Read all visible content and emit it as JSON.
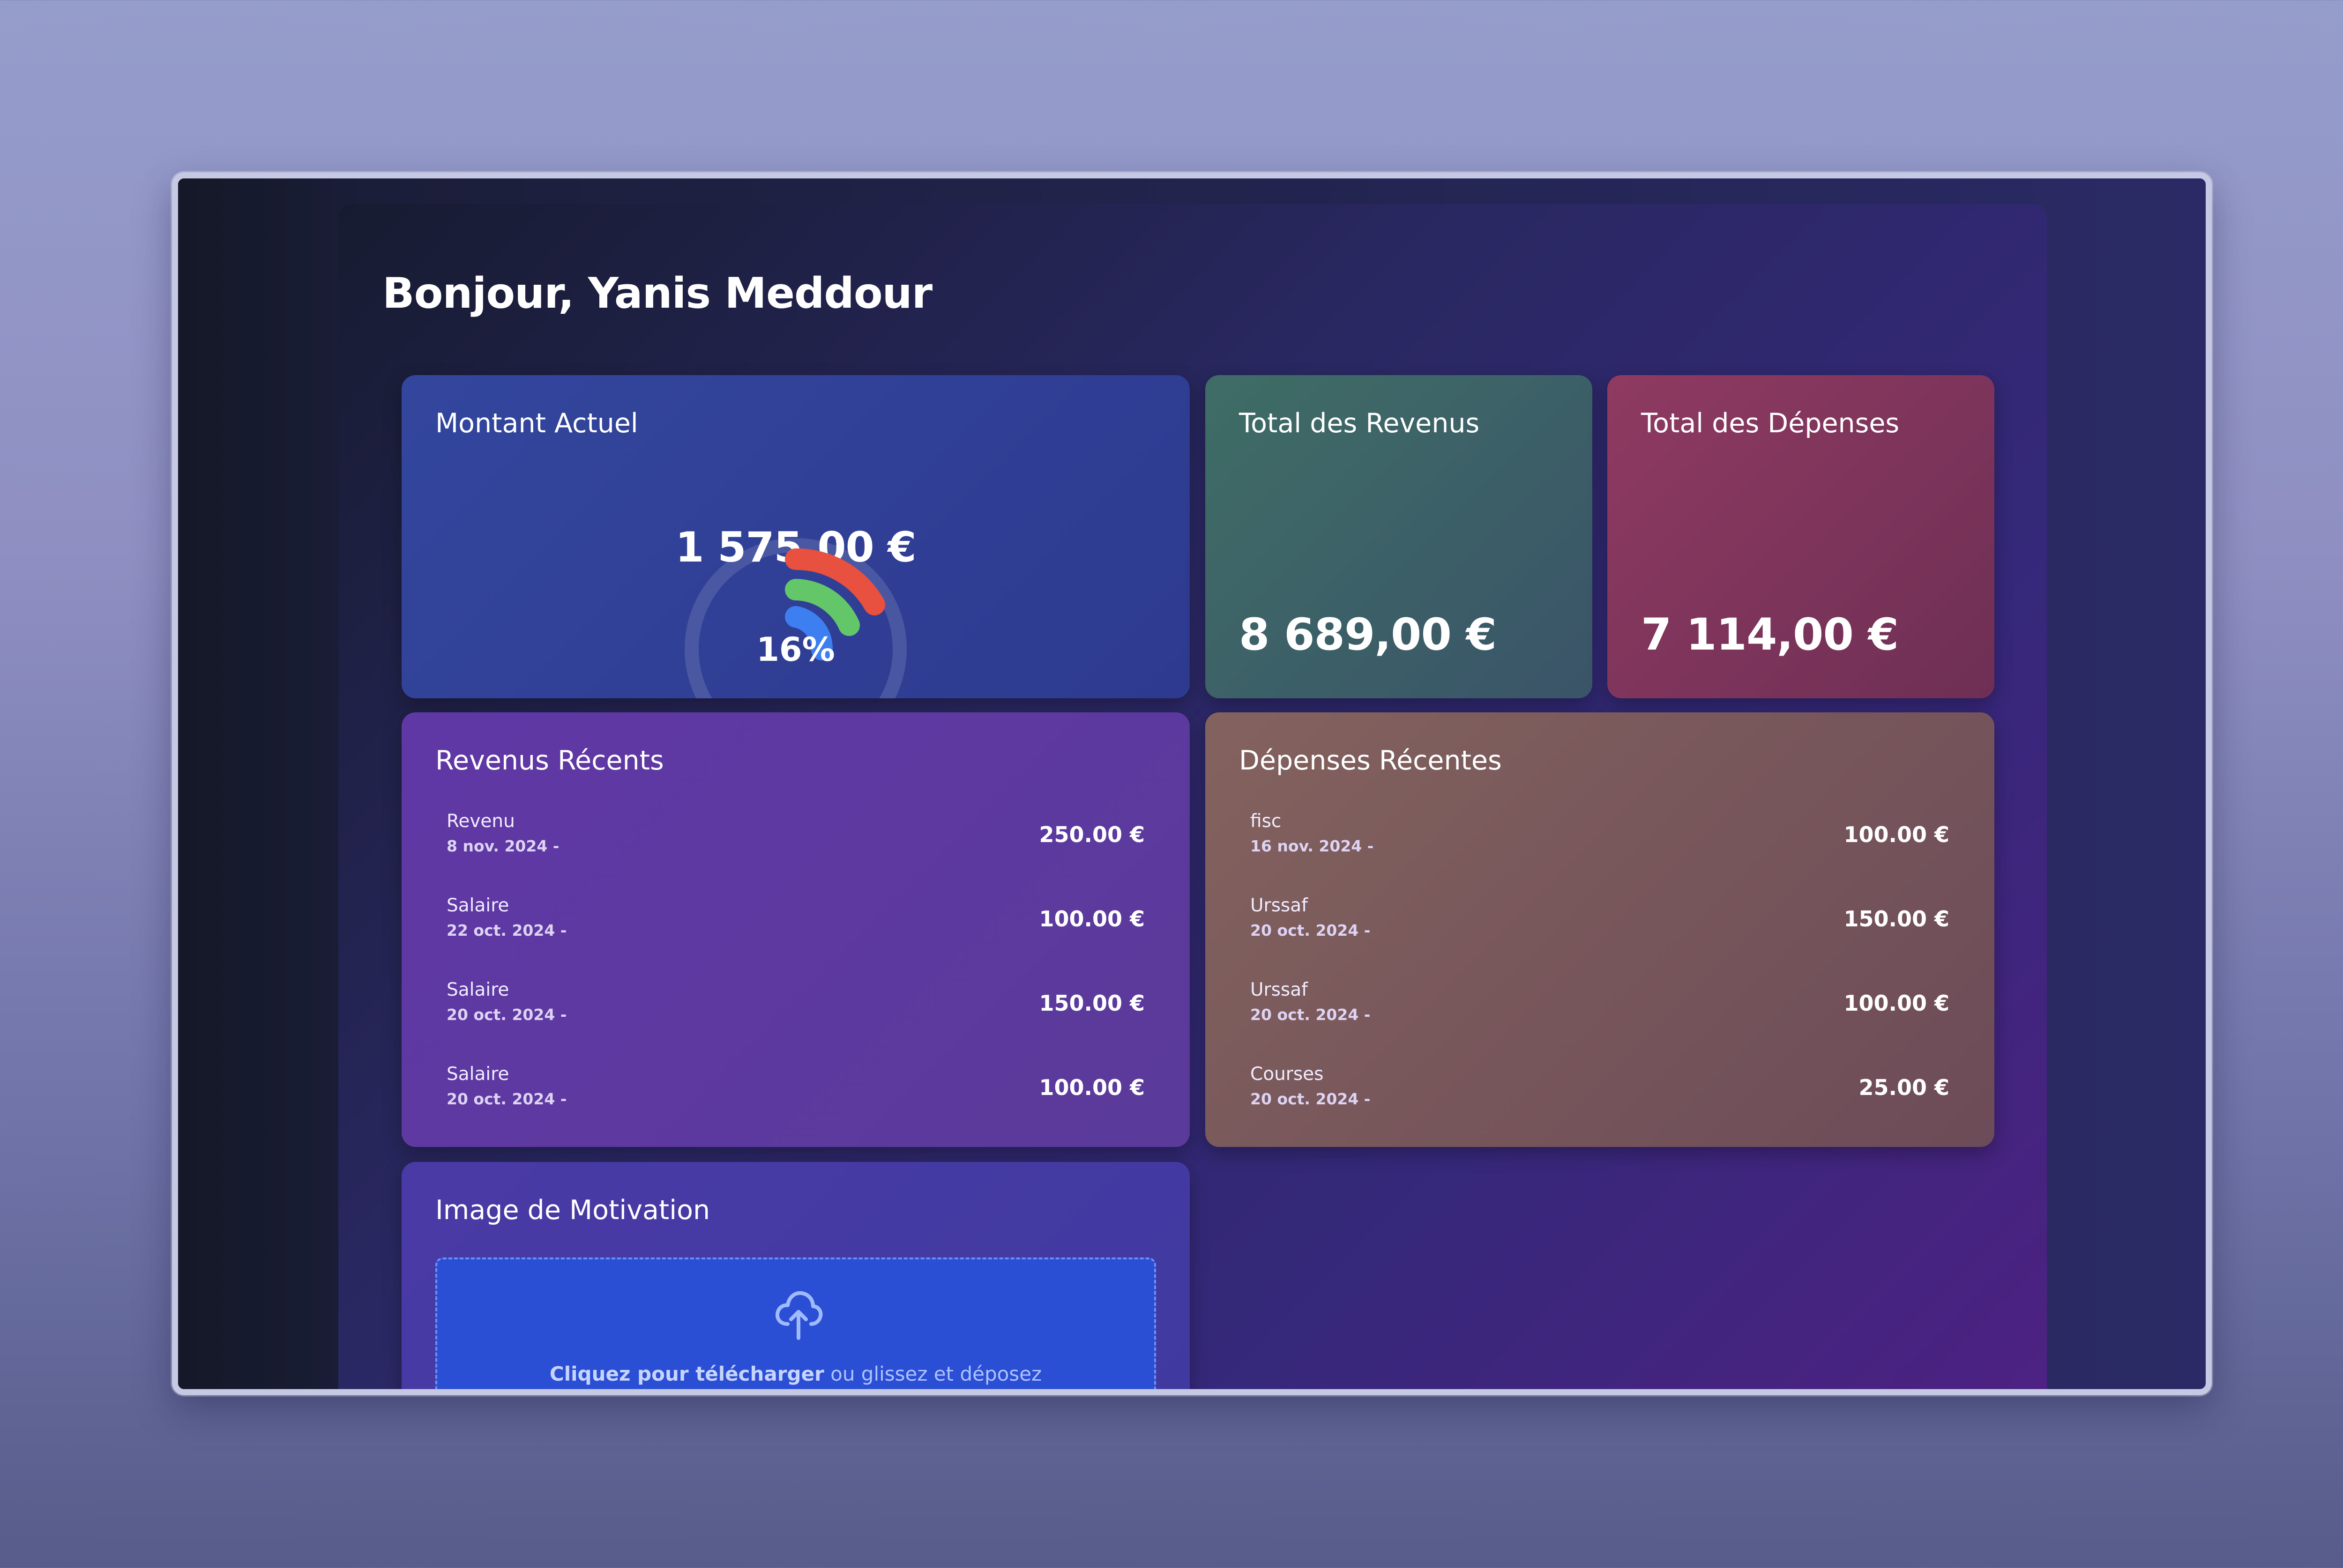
{
  "greeting": "Bonjour, Yanis Meddour",
  "montant": {
    "title": "Montant Actuel",
    "value": "1 575,00 €",
    "percent_label": "16%",
    "percent": 16,
    "gauge_colors": [
      "#e8503f",
      "#63c76a",
      "#3d7ef0"
    ]
  },
  "revenus_total": {
    "title": "Total des Revenus",
    "value": "8 689,00 €"
  },
  "depenses_total": {
    "title": "Total des Dépenses",
    "value": "7 114,00 €"
  },
  "revenus_recents": {
    "title": "Revenus Récents",
    "items": [
      {
        "label": "Revenu",
        "date": "8 nov. 2024 -",
        "amount": "250.00 €"
      },
      {
        "label": "Salaire",
        "date": "22 oct. 2024 -",
        "amount": "100.00 €"
      },
      {
        "label": "Salaire",
        "date": "20 oct. 2024 -",
        "amount": "150.00 €"
      },
      {
        "label": "Salaire",
        "date": "20 oct. 2024 -",
        "amount": "100.00 €"
      }
    ]
  },
  "depenses_recentes": {
    "title": "Dépenses Récentes",
    "items": [
      {
        "label": "fisc",
        "date": "16 nov. 2024 -",
        "amount": "100.00 €"
      },
      {
        "label": "Urssaf",
        "date": "20 oct. 2024 -",
        "amount": "150.00 €"
      },
      {
        "label": "Urssaf",
        "date": "20 oct. 2024 -",
        "amount": "100.00 €"
      },
      {
        "label": "Courses",
        "date": "20 oct. 2024 -",
        "amount": "25.00 €"
      }
    ]
  },
  "motivation": {
    "title": "Image de Motivation",
    "upload_strong": "Cliquez pour télécharger",
    "upload_rest": " ou glissez et déposez",
    "icon": "cloud-upload-icon"
  }
}
